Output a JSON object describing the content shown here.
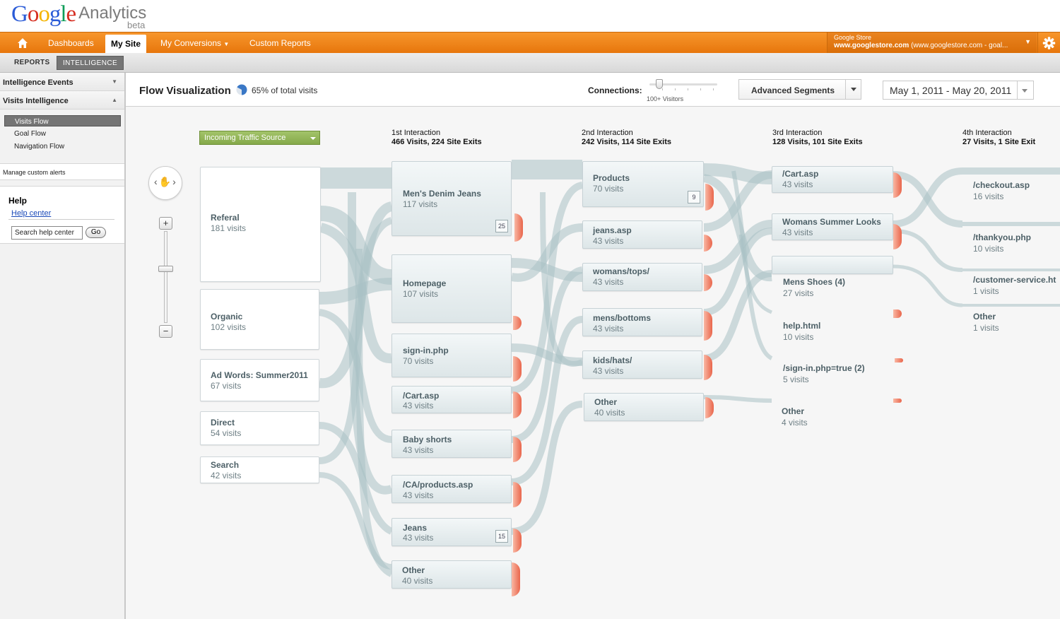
{
  "logo": {
    "brand": "Google",
    "product": "Analytics",
    "badge": "beta"
  },
  "nav": {
    "home_icon": "home-icon",
    "items": [
      "Dashboards",
      "My Site",
      "My Conversions",
      "Custom Reports"
    ],
    "account_line1": "Google Store",
    "account_line2_bold": "www.googlestore.com",
    "account_line2_rest": "(www.googlestore.com - goal...",
    "gear_icon": "gear-icon"
  },
  "subnav": {
    "reports": "REPORTS",
    "intelligence": "INTELLIGENCE"
  },
  "sidebar": {
    "section1": "Intelligence Events",
    "section2": "Visits Intelligence",
    "flows": [
      "Visits Flow",
      "Goal Flow",
      "Navigation Flow"
    ],
    "alerts": "Manage custom alerts",
    "help_title": "Help",
    "help_link": "Help center",
    "search_value": "Search help center",
    "go": "Go"
  },
  "toolbar": {
    "title": "Flow Visualization",
    "pct": "65% of total visits",
    "connections_label": "Connections:",
    "visitors": "100+ Visitors",
    "segments": "Advanced Segments",
    "date_range": "May 1, 2011 - May 20, 2011"
  },
  "flow": {
    "source_select": "Incoming Traffic Source",
    "columns": [
      {
        "title": "1st Interaction",
        "stats": "466 Visits,  224 Site Exits"
      },
      {
        "title": "2nd Interaction",
        "stats": "242 Visits,  114 Site Exits"
      },
      {
        "title": "3rd Interaction",
        "stats": "128 Visits,  101 Site Exits"
      },
      {
        "title": "4th Interaction",
        "stats": "27 Visits, 1 Site Exit"
      }
    ],
    "sources": [
      {
        "name": "Referal",
        "visits": "181 visits"
      },
      {
        "name": "Organic",
        "visits": "102 visits"
      },
      {
        "name": "Ad Words: Summer2011",
        "visits": "67 visits"
      },
      {
        "name": "Direct",
        "visits": "54 visits"
      },
      {
        "name": "Search",
        "visits": "42 visits"
      }
    ],
    "first": [
      {
        "name": "Men's Denim Jeans",
        "visits": "117 visits",
        "count": "25"
      },
      {
        "name": "Homepage",
        "visits": "107 visits"
      },
      {
        "name": "sign-in.php",
        "visits": "70 visits"
      },
      {
        "name": "/Cart.asp",
        "visits": "43 visits"
      },
      {
        "name": "Baby shorts",
        "visits": "43 visits"
      },
      {
        "name": "/CA/products.asp",
        "visits": "43 visits"
      },
      {
        "name": "Jeans",
        "visits": "43 visits",
        "count": "15"
      },
      {
        "name": "Other",
        "visits": "40 visits"
      }
    ],
    "second": [
      {
        "name": "Products",
        "visits": "70 visits",
        "count": "9"
      },
      {
        "name": "jeans.asp",
        "visits": "43 visits"
      },
      {
        "name": "womans/tops/",
        "visits": "43 visits"
      },
      {
        "name": "mens/bottoms",
        "visits": "43 visits"
      },
      {
        "name": "kids/hats/",
        "visits": "43 visits"
      },
      {
        "name": "Other",
        "visits": "40 visits"
      }
    ],
    "third": [
      {
        "name": "/Cart.asp",
        "visits": "43 visits"
      },
      {
        "name": "Womans Summer Looks",
        "visits": "43 visits"
      },
      {
        "name": "Mens Shoes (4)",
        "visits": "27 visits"
      },
      {
        "name": "help.html",
        "visits": "10 visits"
      },
      {
        "name": "/sign-in.php=true (2)",
        "visits": "5 visits"
      },
      {
        "name": "Other",
        "visits": "4 visits"
      }
    ],
    "fourth": [
      {
        "name": "/checkout.asp",
        "visits": "16 visits"
      },
      {
        "name": "/thankyou.php",
        "visits": "10 visits"
      },
      {
        "name": "/customer-service.ht",
        "visits": "1 visits"
      },
      {
        "name": "Other",
        "visits": "1 visits"
      }
    ]
  }
}
